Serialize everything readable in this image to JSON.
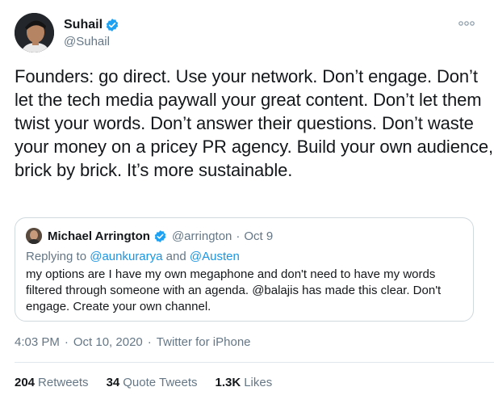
{
  "author": {
    "name": "Suhail",
    "handle": "@Suhail",
    "verified": true
  },
  "tweet_text": "Founders: go direct. Use your network. Don’t engage. Don’t let the tech media paywall your great content. Don’t let them twist your words. Don’t answer their questions. Don’t waste your money on a pricey PR agency. Build your own audience, brick by brick. It’s more sustainable.",
  "quoted": {
    "name": "Michael Arrington",
    "handle": "@arrington",
    "date": "Oct 9",
    "separator": "·",
    "replying_prefix": "Replying to",
    "replying_to_1": "@aunkurarya",
    "replying_joiner": "and",
    "replying_to_2": "@Austen",
    "text": "my options are I have my own megaphone and don't need to have my words filtered through someone with an agenda. @balajis has made this clear. Don't engage. Create your own channel."
  },
  "meta": {
    "time": "4:03 PM",
    "date": "Oct 10, 2020",
    "source": "Twitter for iPhone",
    "separator": "·"
  },
  "stats": {
    "retweets_count": "204",
    "retweets_label": "Retweets",
    "quotes_count": "34",
    "quotes_label": "Quote Tweets",
    "likes_count": "1.3K",
    "likes_label": "Likes"
  },
  "colors": {
    "verified_blue": "#1da1f2",
    "link_blue": "#1b95e0",
    "secondary_text": "#657786",
    "border": "#cfd9de"
  },
  "icons": {
    "verified": "verified-badge-icon",
    "more": "more-options-icon"
  }
}
